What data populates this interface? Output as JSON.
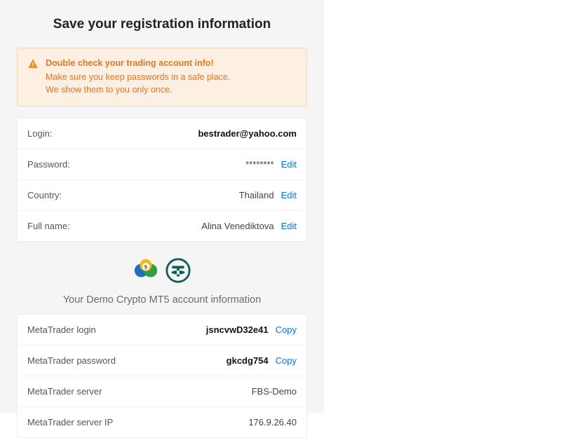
{
  "title": "Save your registration information",
  "warning": {
    "title": "Double check your trading account info!",
    "line1": "Make sure you keep passwords in a safe place.",
    "line2": "We show them to you only once."
  },
  "registration": {
    "login_label": "Login:",
    "login_value": "bestrader@yahoo.com",
    "password_label": "Password:",
    "password_value": "********",
    "country_label": "Country:",
    "country_value": "Thailand",
    "fullname_label": "Full name:",
    "fullname_value": "Alina Venediktova",
    "edit_label": "Edit"
  },
  "account_section": {
    "heading": "Your Demo Crypto MT5 account information",
    "icons": {
      "mt5": "mt5-icon",
      "tether": "tether-icon"
    }
  },
  "account": {
    "mt_login_label": "MetaTrader login",
    "mt_login_value": "jsncvwD32e41",
    "mt_password_label": "MetaTrader password",
    "mt_password_value": "gkcdg754",
    "mt_server_label": "MetaTrader server",
    "mt_server_value": "FBS-Demo",
    "mt_server_ip_label": "MetaTrader server IP",
    "mt_server_ip_value": "176.9.26.40",
    "copy_label": "Copy"
  },
  "colors": {
    "link": "#0b74de",
    "warn_bg": "#fdefe2",
    "warn_text": "#e6781f"
  }
}
